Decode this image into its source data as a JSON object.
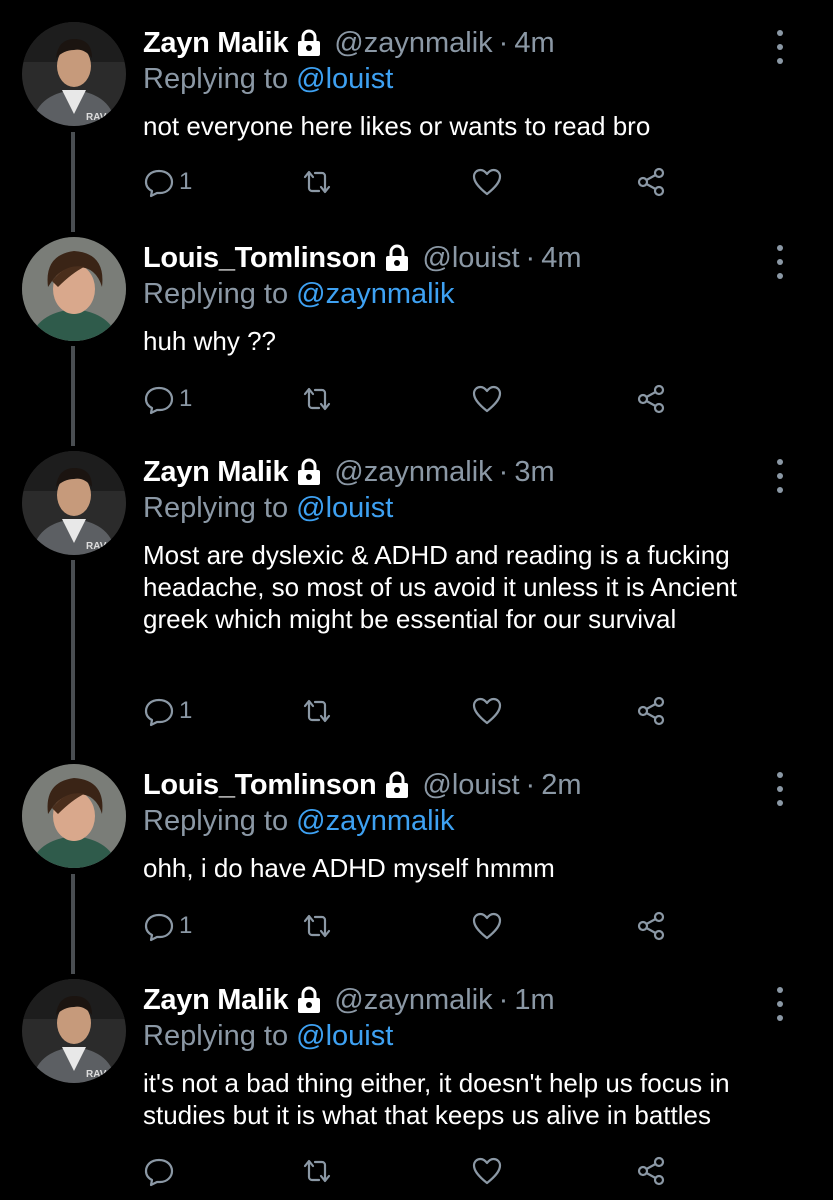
{
  "tweets": [
    {
      "name": "Zayn Malik",
      "handle": "@zaynmalik",
      "time": "4m",
      "replying_prefix": "Replying to",
      "replying_to": "@louist",
      "text": "not everyone here likes or wants to read bro",
      "reply_count": "1",
      "avatar": "zayn"
    },
    {
      "name": "Louis_Tomlinson",
      "handle": "@louist",
      "time": "4m",
      "replying_prefix": "Replying to",
      "replying_to": "@zaynmalik",
      "text": "huh why ??",
      "reply_count": "1",
      "avatar": "louis"
    },
    {
      "name": "Zayn Malik",
      "handle": "@zaynmalik",
      "time": "3m",
      "replying_prefix": "Replying to",
      "replying_to": "@louist",
      "text": "Most are dyslexic & ADHD and reading is a fucking headache, so most of us avoid it unless it is Ancient greek which might be essential for our survival",
      "reply_count": "1",
      "avatar": "zayn"
    },
    {
      "name": "Louis_Tomlinson",
      "handle": "@louist",
      "time": "2m",
      "replying_prefix": "Replying to",
      "replying_to": "@zaynmalik",
      "text": "ohh, i do have ADHD myself hmmm",
      "reply_count": "1",
      "avatar": "louis"
    },
    {
      "name": "Zayn Malik",
      "handle": "@zaynmalik",
      "time": "1m",
      "replying_prefix": "Replying to",
      "replying_to": "@louist",
      "text": "it's not a bad thing either, it doesn't help us focus in studies but it is what that keeps us alive in battles",
      "reply_count": "",
      "avatar": "zayn"
    }
  ],
  "avatar_badge_text": "RAV",
  "icons": {
    "protected": "lock-icon",
    "more": "more-vertical-icon",
    "reply": "reply-icon",
    "retweet": "retweet-icon",
    "like": "heart-icon",
    "share": "share-icon"
  },
  "colors": {
    "background": "#000000",
    "text": "#ffffff",
    "secondary": "#8b98a5",
    "mention": "#3ea1f2",
    "thread_line": "#4a4e52"
  }
}
